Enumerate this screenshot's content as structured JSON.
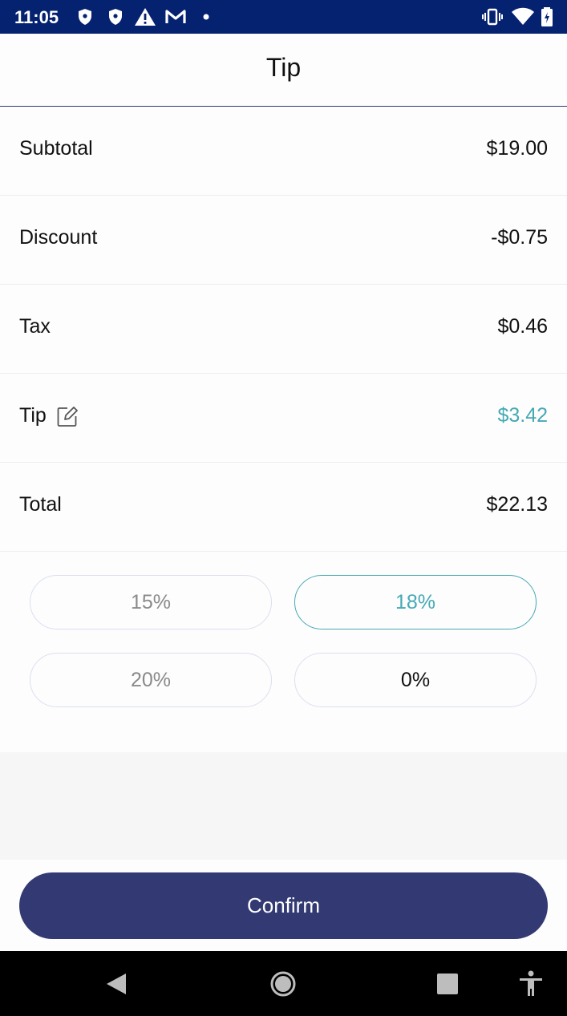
{
  "status_bar": {
    "time": "11:05",
    "icons": [
      "shield-icon",
      "shield-icon",
      "warning-icon",
      "gmail-icon",
      "dot-icon",
      "vibrate-icon",
      "wifi-icon",
      "battery-icon"
    ],
    "background": "#052270"
  },
  "header": {
    "title": "Tip"
  },
  "summary": {
    "rows": [
      {
        "label": "Subtotal",
        "value": "$19.00"
      },
      {
        "label": "Discount",
        "value": "-$0.75"
      },
      {
        "label": "Tax",
        "value": "$0.46"
      },
      {
        "label": "Tip",
        "value": "$3.42",
        "icon": "edit-icon"
      },
      {
        "label": "Total",
        "value": "$22.13"
      }
    ]
  },
  "tip_options": [
    {
      "label": "15%",
      "selected": false
    },
    {
      "label": "18%",
      "selected": true
    },
    {
      "label": "20%",
      "selected": false
    },
    {
      "label": "0%",
      "selected": false
    }
  ],
  "confirm": {
    "label": "Confirm"
  },
  "nav_bar": {
    "icons": [
      "back-icon",
      "home-icon",
      "recents-icon",
      "accessibility-icon"
    ]
  },
  "colors": {
    "accent": "#46a9b4",
    "primary": "#333a73",
    "divider": "#2f3a6e"
  }
}
